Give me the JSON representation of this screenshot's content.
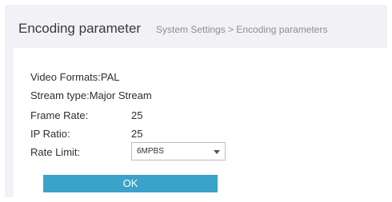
{
  "header": {
    "title": "Encoding parameter",
    "breadcrumb": "System Settings > Encoding parameters"
  },
  "form": {
    "video_formats": "Video Formats:PAL",
    "stream_type": "Stream type:Major Stream",
    "frame_rate_label": "Frame Rate:",
    "frame_rate_value": "25",
    "ip_ratio_label": "IP Ratio:",
    "ip_ratio_value": "25",
    "rate_limit_label": "Rate Limit:",
    "rate_limit_value": "6MPBS"
  },
  "buttons": {
    "ok": "OK"
  }
}
